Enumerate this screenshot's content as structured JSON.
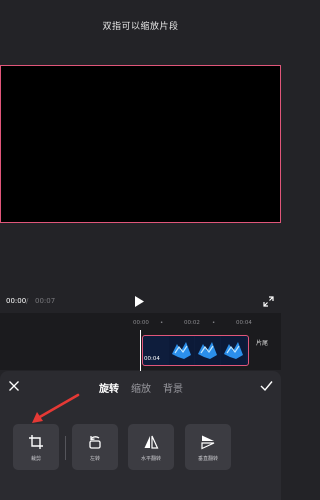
{
  "header": {
    "hint": "双指可以缩放片段"
  },
  "player": {
    "current_time": "00:00",
    "separator": "/",
    "total_time": "00:07"
  },
  "timeline": {
    "ruler_labels": [
      "00:00",
      "00:02",
      "00:04"
    ],
    "clip_duration": "00:04",
    "end_label": "片尾"
  },
  "panel": {
    "tabs": [
      "旋转",
      "缩放",
      "背景"
    ],
    "active_tab": 0,
    "tools": [
      {
        "label": "裁剪",
        "icon": "crop-icon"
      },
      {
        "label": "左转",
        "icon": "rotate-left-icon"
      },
      {
        "label": "水平翻转",
        "icon": "flip-horizontal-icon"
      },
      {
        "label": "垂直翻转",
        "icon": "flip-vertical-icon"
      }
    ]
  },
  "colors": {
    "accent": "#e0567a",
    "arrow": "#e53935",
    "background": "#232327",
    "panel": "#2b2b30"
  }
}
